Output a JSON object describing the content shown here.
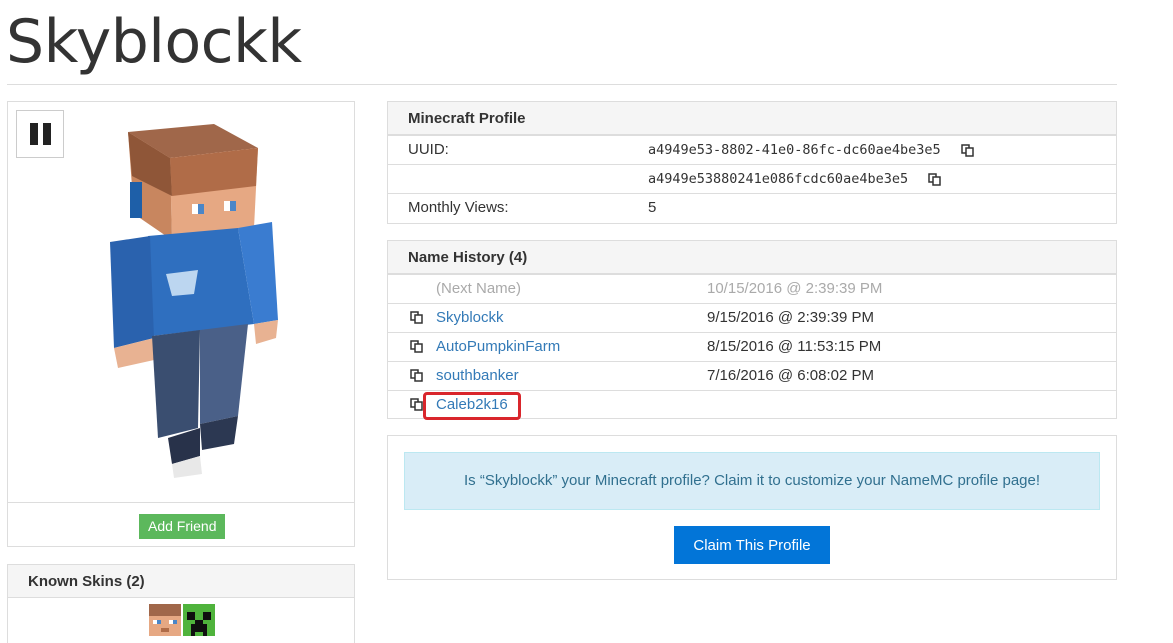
{
  "header": {
    "title": "Skyblockk"
  },
  "skin_viewer": {
    "pause_icon": "pause-icon",
    "add_friend_label": "Add Friend"
  },
  "known_skins": {
    "heading": "Known Skins (2)",
    "skins": [
      "steve-style-blue-hoodie-skin",
      "creeper-skin"
    ]
  },
  "profile": {
    "heading": "Minecraft Profile",
    "uuid_label": "UUID:",
    "uuid": "a4949e53-8802-41e0-86fc-dc60ae4be3e5",
    "uuid_plain": "a4949e53880241e086fcdc60ae4be3e5",
    "views_label": "Monthly Views:",
    "views": "5"
  },
  "name_history": {
    "heading": "Name History (4)",
    "rows": [
      {
        "name": "(Next Name)",
        "date": "10/15/2016 @ 2:39:39 PM"
      },
      {
        "name": "Skyblockk",
        "date": "9/15/2016 @ 2:39:39 PM"
      },
      {
        "name": "AutoPumpkinFarm",
        "date": "8/15/2016 @ 11:53:15 PM"
      },
      {
        "name": "southbanker",
        "date": "7/16/2016 @ 6:08:02 PM"
      },
      {
        "name": "Caleb2k16",
        "date": ""
      }
    ]
  },
  "claim": {
    "message": "Is “Skyblockk” your Minecraft profile? Claim it to customize your NameMC profile page!",
    "button_label": "Claim This Profile"
  },
  "colors": {
    "link": "#337ab7",
    "success": "#5cb85c",
    "primary": "#0275d8",
    "info_bg": "#d9edf7",
    "highlight": "#d9262c"
  }
}
